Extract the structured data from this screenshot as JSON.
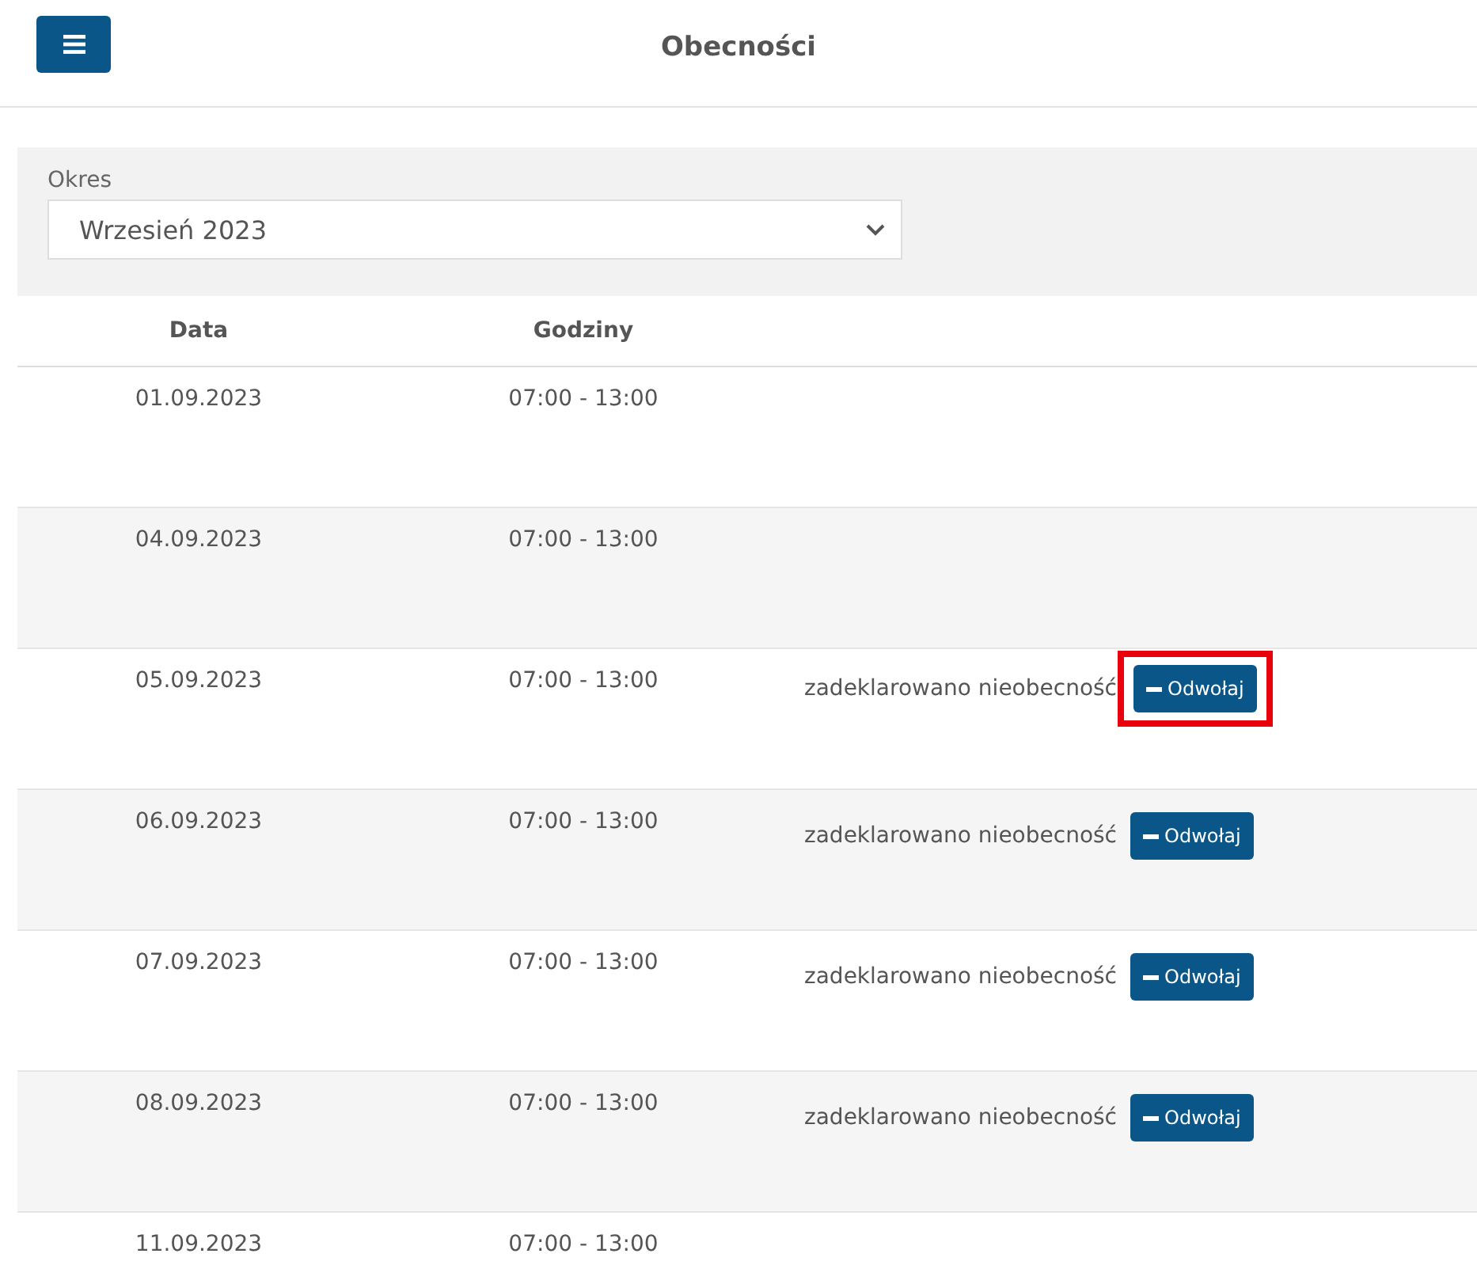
{
  "header": {
    "title": "Obecności"
  },
  "filter": {
    "label": "Okres",
    "value": "Wrzesień 2023"
  },
  "table": {
    "columns": [
      "Data",
      "Godziny"
    ],
    "rows": [
      {
        "date": "01.09.2023",
        "hours": "07:00 - 13:00"
      },
      {
        "date": "04.09.2023",
        "hours": "07:00 - 13:00"
      },
      {
        "date": "05.09.2023",
        "hours": "07:00 - 13:00",
        "status": "zadeklarowano nieobecność",
        "action": {
          "label": "Odwołaj",
          "highlighted": true
        }
      },
      {
        "date": "06.09.2023",
        "hours": "07:00 - 13:00",
        "status": "zadeklarowano nieobecność",
        "action": {
          "label": "Odwołaj",
          "highlighted": false
        }
      },
      {
        "date": "07.09.2023",
        "hours": "07:00 - 13:00",
        "status": "zadeklarowano nieobecność",
        "action": {
          "label": "Odwołaj",
          "highlighted": false
        }
      },
      {
        "date": "08.09.2023",
        "hours": "07:00 - 13:00",
        "status": "zadeklarowano nieobecność",
        "action": {
          "label": "Odwołaj",
          "highlighted": false
        }
      },
      {
        "date": "11.09.2023",
        "hours": "07:00 - 13:00"
      }
    ]
  }
}
